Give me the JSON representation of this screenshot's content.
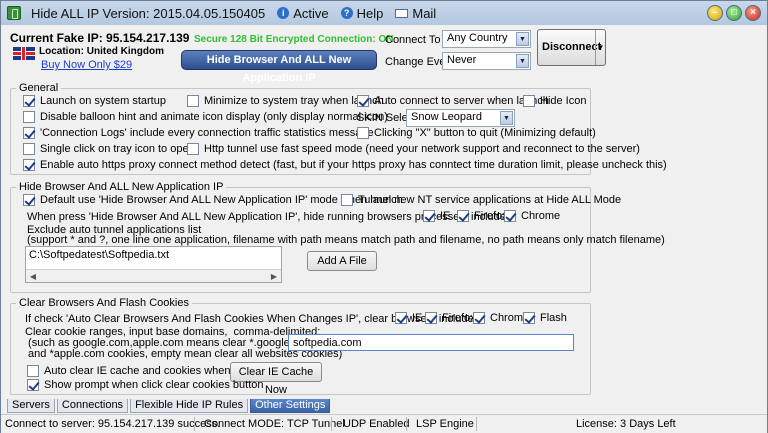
{
  "titlebar": {
    "title": "Hide ALL IP  Version: 2015.04.05.150405",
    "active": "Active",
    "help": "Help",
    "mail": "Mail"
  },
  "header": {
    "fake_ip": "Current Fake IP: 95.154.217.139",
    "location": "Location: United Kingdom",
    "buy_now": "Buy Now Only $29",
    "secure": "Secure 128 Bit Encrypted Connection: ON",
    "hide_button": "Hide Browser And ALL New Application IP",
    "connect_to_label": "Connect To",
    "connect_to_value": "Any Country",
    "change_every_label": "Change Every",
    "change_every_value": "Never",
    "disconnect": "Disconnect"
  },
  "general": {
    "title": "General",
    "launch_startup": "Launch on system startup",
    "minimize_tray": "Minimize to system tray when launch",
    "auto_connect": "Auto connect to server when launch",
    "hide_icon": "Hide Icon",
    "disable_balloon": "Disable balloon hint and animate icon display (only display normal icon)",
    "skin_label": "SKIN Select",
    "skin_value": "Snow Leopard",
    "connection_logs": "'Connection Logs' include every connection traffic statistics message",
    "clicking_x": "Clicking \"X\" button to quit (Minimizing default)",
    "single_click": "Single click on tray icon to open",
    "http_tunnel": "Http tunnel use fast speed mode (need your network support and reconnect to the server)",
    "https_proxy": "Enable auto https proxy connect method detect (fast,  but if your https proxy has conntect time duration limit, please uncheck this)"
  },
  "hide_browser": {
    "title": "Hide Browser And ALL New Application IP",
    "default_use": "Default use 'Hide Browser And ALL New Application IP' mode when launch",
    "tunnel_nt": "Tunnel new NT service applications at Hide ALL Mode",
    "when_press": "When press 'Hide Browser And ALL New Application IP', hide running browsers processes, include:",
    "ie": "IE",
    "firefox": "Firefox",
    "chrome": "Chrome",
    "exclude_title": "Exclude auto tunnel applications list",
    "exclude_hint": "  (support * and ?, one line one application, filename with path means match path and filename,  no path means only match filename)",
    "exclude_item": "C:\\Softpedatest\\Softpedia.txt",
    "add_file": "Add A File"
  },
  "clear_cookies": {
    "title": "Clear Browsers And Flash Cookies",
    "if_check": "If check 'Auto Clear Browsers And Flash Cookies When Changes IP', clear browsers include:",
    "ie": "IE",
    "firefox": "Firefox",
    "chrome": "Chrome",
    "flash": "Flash",
    "ranges_text": "Clear cookie ranges, input base domains,  comma-delimited:\n (such as google.com,apple.com means clear *.google.com\n and *apple.com cookies, empty mean clear all websites cookies)",
    "domains_value": "softpedia.com",
    "auto_clear_ie": "Auto clear IE cache and cookies when quit",
    "clear_ie_button": "Clear IE Cache Now",
    "show_prompt": "Show prompt when click clear cookies button"
  },
  "tabs": [
    "Servers",
    "Connections",
    "Flexible Hide IP Rules",
    "Other Settings"
  ],
  "status": {
    "connected": "Connect to server: 95.154.217.139 success.",
    "mode": "Connect MODE: TCP Tunnel",
    "udp": "UDP Enabled",
    "lsp": "LSP Engine",
    "license": "License: 3 Days Left"
  },
  "colors": {
    "accent": "#3a64a8",
    "secure_text": "#2fbf2f",
    "link": "#1a3fcf"
  }
}
